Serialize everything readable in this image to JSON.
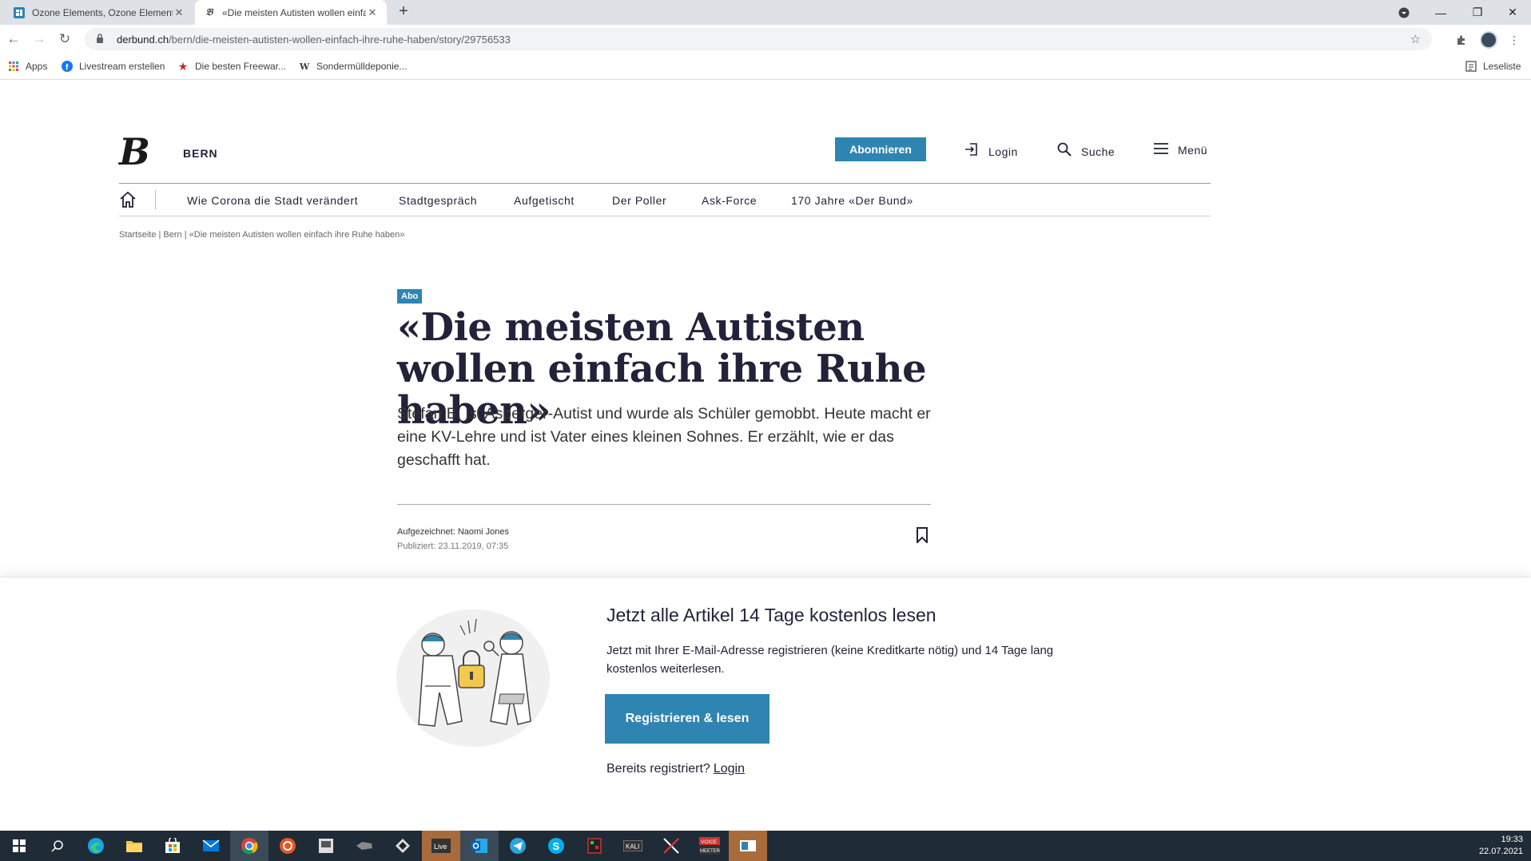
{
  "browser": {
    "tabs": [
      {
        "title": "Ozone Elements, Ozone Elements",
        "favicon": "ozone-icon",
        "active": false
      },
      {
        "title": "«Die meisten Autisten wollen einfach",
        "favicon": "derbund-icon",
        "active": true
      }
    ],
    "new_tab": "+",
    "url_host": "derbund.ch",
    "url_path": "/bern/die-meisten-autisten-wollen-einfach-ihre-ruhe-haben/story/29756533",
    "bookmarks": [
      {
        "label": "Apps",
        "icon": "apps-grid-icon"
      },
      {
        "label": "Livestream erstellen",
        "icon": "facebook-icon"
      },
      {
        "label": "Die besten Freewar...",
        "icon": "star-icon"
      },
      {
        "label": "Sondermülldeponie...",
        "icon": "wikipedia-icon"
      }
    ],
    "reading_list": "Leseliste"
  },
  "site": {
    "logo": "B",
    "region": "BERN",
    "subscribe": "Abonnieren",
    "login": "Login",
    "search": "Suche",
    "menu": "Menü",
    "nav": [
      "Wie Corona die Stadt verändert",
      "Stadtgespräch",
      "Aufgetischt",
      "Der Poller",
      "Ask-Force",
      "170 Jahre «Der Bund»"
    ],
    "breadcrumb": "Startseite | Bern | «Die meisten Autisten wollen einfach ihre Ruhe haben»"
  },
  "article": {
    "badge": "Abo",
    "headline": "«Die meisten Autisten wollen einfach ihre Ruhe haben»",
    "lead": "Stefan B. ist Asperger-Autist und wurde als Schüler gemobbt. Heute macht er eine KV-Lehre und ist Vater eines kleinen Sohnes. Er erzählt, wie er das geschafft hat.",
    "byline": "Aufgezeichnet: Naomi Jones",
    "published": "Publiziert: 23.11.2019, 07:35"
  },
  "paywall": {
    "title": "Jetzt alle Artikel 14 Tage kostenlos lesen",
    "text": "Jetzt mit Ihrer E-Mail-Adresse registrieren (keine Kreditkarte nötig) und 14 Tage lang kostenlos weiterlesen.",
    "button": "Registrieren & lesen",
    "already": "Bereits registriert?",
    "login": "Login"
  },
  "taskbar": {
    "apps": [
      "windows-start-icon",
      "search-icon",
      "edge-icon",
      "file-explorer-icon",
      "store-icon",
      "mail-icon",
      "chrome-icon",
      "ubuntu-icon",
      "app-icon",
      "app-icon",
      "app-icon",
      "live-icon",
      "outlook-icon",
      "telegram-icon",
      "skype-icon",
      "app-icon",
      "kali-icon",
      "app-icon",
      "voicemeeter-icon",
      "app-icon"
    ],
    "time": "19:33",
    "date": "22.07.2021"
  },
  "colors": {
    "accent": "#2e85b1",
    "text_dark": "#22223a",
    "taskbar": "#1f2b36"
  }
}
